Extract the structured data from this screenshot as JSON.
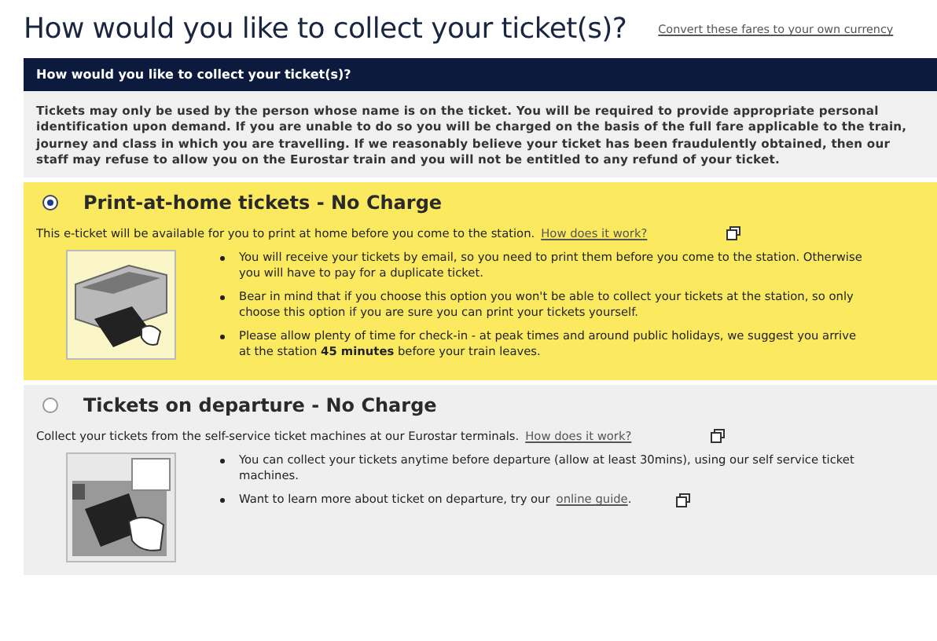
{
  "page_title": "How would you like to collect your ticket(s)?",
  "currency_link": "Convert these fares to your own currency",
  "panel": {
    "heading": "How would you like to collect your ticket(s)?",
    "notice": "Tickets may only be used by the person whose name is on the ticket. You will be required to provide appropriate personal identification upon demand. If you are unable to do so you will be charged on the basis of the full fare applicable to the train, journey and class in which you are travelling. If we reasonably believe your ticket has been fraudulently obtained, then our staff may refuse to allow you on the Eurostar train and you will not be entitled to any refund of your ticket."
  },
  "options": [
    {
      "title": "Print-at-home tickets - No Charge",
      "selected": true,
      "kind": "printer",
      "description": "This e-ticket will be available for you to print at home before you come to the station.",
      "link": "How does it work?",
      "bullets": [
        {
          "text": "You will receive your tickets by email, so you need to print them before you come to the station. Otherwise you will have to pay for a duplicate ticket."
        },
        {
          "text": "Bear in mind that if you choose this option you won't be able to collect your tickets at the station, so only choose this option if you are sure you can print your tickets yourself."
        },
        {
          "text": "Please allow plenty of time for check-in - at peak times and around public holidays, we suggest you arrive at the station **45 minutes** before your train leaves."
        }
      ]
    },
    {
      "title": "Tickets on departure - No Charge",
      "selected": false,
      "kind": "machine",
      "description": "Collect your tickets from the self-service ticket machines at our Eurostar terminals.",
      "link": "How does it work?",
      "bullets": [
        {
          "text": "You can collect your tickets anytime before departure (allow at least 30mins), using our self service ticket machines."
        },
        {
          "text": "Want to learn more about ticket on departure, try our",
          "link": "online guide",
          "after": "."
        }
      ]
    }
  ]
}
